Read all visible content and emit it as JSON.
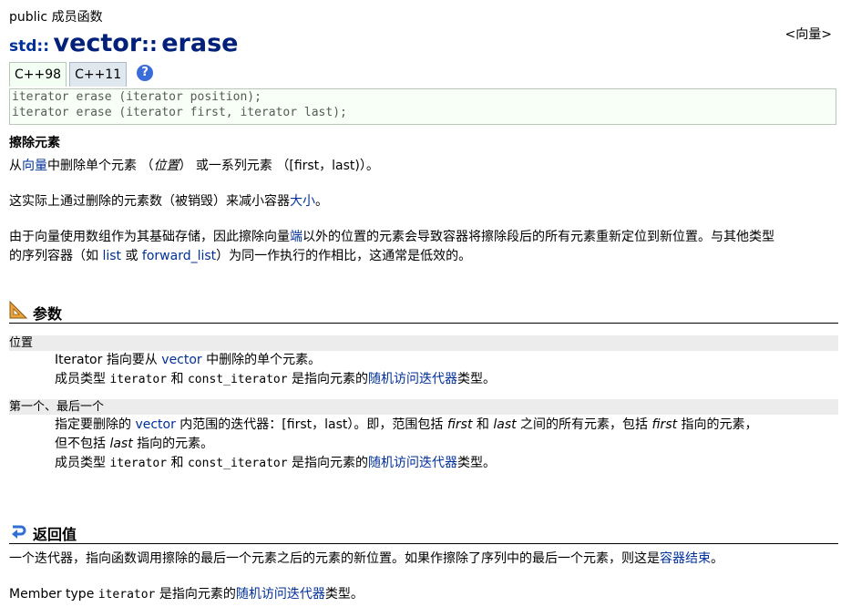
{
  "header": {
    "kind": "public 成员函数",
    "namespace": "std::",
    "class_name": "vector",
    "scope_sep": "::",
    "function": "erase",
    "header_link": "<向量>"
  },
  "tabs": [
    "C++98",
    "C++11"
  ],
  "help_icon_label": "?",
  "prototypes": [
    "iterator erase (iterator position);",
    "iterator erase (iterator first, iterator last);"
  ],
  "description": {
    "summary": "擦除元素",
    "line1": {
      "a": "从",
      "link_vector": "向量",
      "b": "中删除单个元素 （",
      "em": "位置",
      "c": "） 或一系列元素 （[first，last)）。"
    },
    "line2": {
      "a": "这实际上通过删除的元素数（被销毁）来减小容器",
      "link_size": "大小",
      "b": "。"
    },
    "line3": {
      "a": "由于向量使用数组作为其基础存储，因此擦除向量",
      "link_end": "端",
      "b": "以外的位置的元素会导致容器将擦除段后的所有元素重新定位到新位置。与其他类型",
      "c": "的序列容器（如 ",
      "link_list": "list",
      "d": " 或 ",
      "link_fwd": "forward_list",
      "e": "）为同一作执行的作相比，这通常是低效的。"
    }
  },
  "params_section": {
    "title": "参数",
    "items": [
      {
        "term": "位置",
        "desc1": {
          "a": "Iterator 指向要从 ",
          "link": "vector",
          "b": " 中删除的单个元素。"
        },
        "desc2": {
          "a": "成员类型 ",
          "code1": "iterator",
          "b": " 和 ",
          "code2": "const_iterator",
          "c": " 是指向元素的",
          "link": "随机访问迭代器",
          "d": "类型。"
        }
      },
      {
        "term": "第一个、最后一个",
        "desc1": {
          "a": "指定要删除的 ",
          "link": "vector",
          "b": " 内范围的迭代器：[first，last）。即，范围包括 ",
          "em1": "first",
          "c": " 和 ",
          "em2": "last",
          "d": " 之间的所有元素，包括 ",
          "em3": "first",
          "e": " 指向的元素，"
        },
        "desc1b": {
          "a": "但不包括 ",
          "em": "last",
          "b": " 指向的元素。"
        },
        "desc2": {
          "a": "成员类型 ",
          "code1": "iterator",
          "b": " 和 ",
          "code2": "const_iterator",
          "c": " 是指向元素的",
          "link": "随机访问迭代器",
          "d": "类型。"
        }
      }
    ]
  },
  "return_section": {
    "title": "返回值",
    "line1": {
      "a": "一个迭代器，指向函数调用擦除的最后一个元素之后的元素的新位置。如果作擦除了序列中的最后一个元素，则这是",
      "link": "容器结束",
      "b": "。"
    },
    "line2": {
      "a": "Member type ",
      "code": "iterator",
      "b": " 是指向元素的",
      "link": "随机访问迭代器",
      "c": "类型。"
    }
  },
  "colors": {
    "link": "#00309a",
    "title": "#00207a",
    "term_bg": "#ececec",
    "proto_bg": "#f7fff7"
  },
  "icons": {
    "params": "ruler-icon",
    "return": "return-arrow-icon",
    "help": "help-icon"
  }
}
